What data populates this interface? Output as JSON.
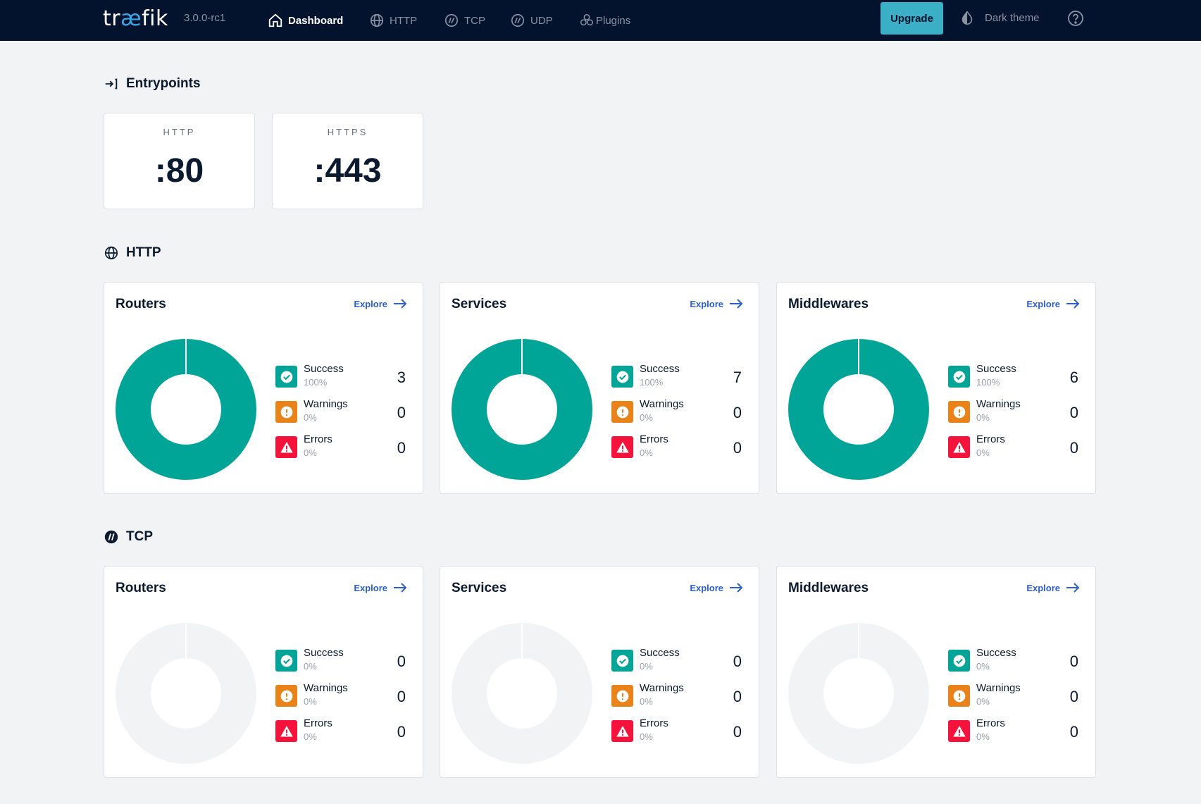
{
  "nav": {
    "logo_pre": "tr",
    "logo_ae": "æ",
    "logo_post": "fik",
    "version": "3.0.0-rc1",
    "items": [
      {
        "label": "Dashboard",
        "icon": "home-icon",
        "active": true
      },
      {
        "label": "HTTP",
        "icon": "globe-icon",
        "active": false
      },
      {
        "label": "TCP",
        "icon": "tcp-icon",
        "active": false
      },
      {
        "label": "UDP",
        "icon": "udp-icon",
        "active": false
      },
      {
        "label": "Plugins",
        "icon": "plugins-icon",
        "active": false
      }
    ],
    "upgrade_label": "Upgrade",
    "theme_label": "Dark theme",
    "help_icon": "question-icon"
  },
  "entrypoints": {
    "title": "Entrypoints",
    "icon": "entrypoint-arrow-icon",
    "items": [
      {
        "name": "HTTP",
        "port": ":80"
      },
      {
        "name": "HTTPS",
        "port": ":443"
      }
    ]
  },
  "http": {
    "title": "HTTP",
    "icon": "globe-icon",
    "cards": [
      {
        "title": "Routers",
        "explore": "Explore",
        "rows": [
          {
            "label": "Success",
            "pct": "100%",
            "count": "3"
          },
          {
            "label": "Warnings",
            "pct": "0%",
            "count": "0"
          },
          {
            "label": "Errors",
            "pct": "0%",
            "count": "0"
          }
        ]
      },
      {
        "title": "Services",
        "explore": "Explore",
        "rows": [
          {
            "label": "Success",
            "pct": "100%",
            "count": "7"
          },
          {
            "label": "Warnings",
            "pct": "0%",
            "count": "0"
          },
          {
            "label": "Errors",
            "pct": "0%",
            "count": "0"
          }
        ]
      },
      {
        "title": "Middlewares",
        "explore": "Explore",
        "rows": [
          {
            "label": "Success",
            "pct": "100%",
            "count": "6"
          },
          {
            "label": "Warnings",
            "pct": "0%",
            "count": "0"
          },
          {
            "label": "Errors",
            "pct": "0%",
            "count": "0"
          }
        ]
      }
    ]
  },
  "tcp": {
    "title": "TCP",
    "icon": "tcp-icon",
    "cards": [
      {
        "title": "Routers",
        "explore": "Explore",
        "rows": [
          {
            "label": "Success",
            "pct": "0%",
            "count": "0"
          },
          {
            "label": "Warnings",
            "pct": "0%",
            "count": "0"
          },
          {
            "label": "Errors",
            "pct": "0%",
            "count": "0"
          }
        ]
      },
      {
        "title": "Services",
        "explore": "Explore",
        "rows": [
          {
            "label": "Success",
            "pct": "0%",
            "count": "0"
          },
          {
            "label": "Warnings",
            "pct": "0%",
            "count": "0"
          },
          {
            "label": "Errors",
            "pct": "0%",
            "count": "0"
          }
        ]
      },
      {
        "title": "Middlewares",
        "explore": "Explore",
        "rows": [
          {
            "label": "Success",
            "pct": "0%",
            "count": "0"
          },
          {
            "label": "Warnings",
            "pct": "0%",
            "count": "0"
          },
          {
            "label": "Errors",
            "pct": "0%",
            "count": "0"
          }
        ]
      }
    ]
  },
  "colors": {
    "success": "#00a597",
    "warning": "#e98218",
    "error": "#f5133b",
    "empty": "#f2f3f5",
    "nav_bg": "#03132e",
    "accent": "#3aafc5",
    "link": "#2b5fcc"
  }
}
